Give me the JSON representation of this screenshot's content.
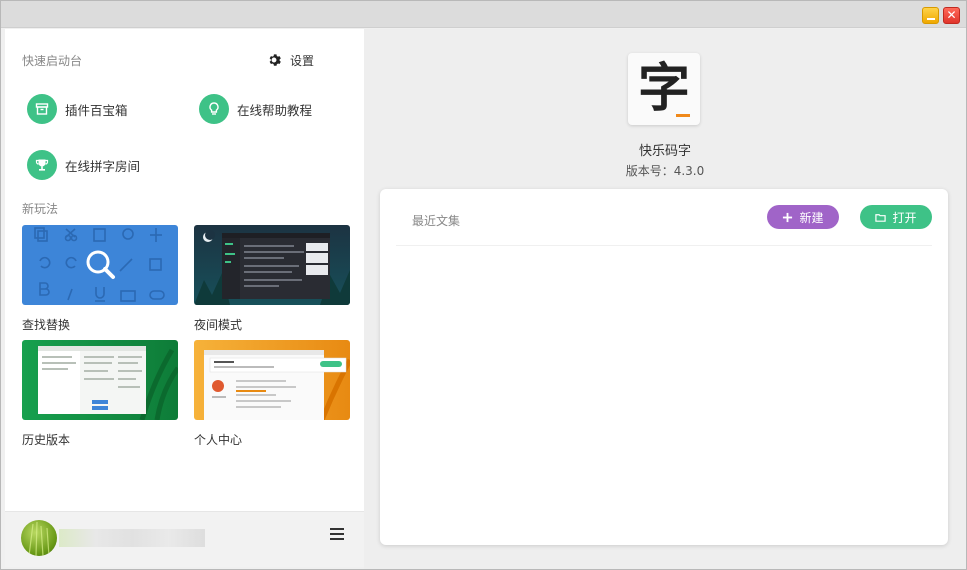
{
  "window": {
    "minimize_icon": "minimize-icon",
    "close_icon": "close-icon",
    "close_glyph": "✕"
  },
  "left": {
    "quick_start_title": "快速启动台",
    "settings_label": "设置",
    "tools": [
      {
        "label": "插件百宝箱",
        "icon": "archive-box-icon"
      },
      {
        "label": "在线帮助教程",
        "icon": "lightbulb-icon"
      },
      {
        "label": "在线拼字房间",
        "icon": "trophy-icon"
      }
    ],
    "new_play_title": "新玩法",
    "features": [
      {
        "label": "查找替换",
        "theme": "#3d85d8"
      },
      {
        "label": "夜间模式",
        "theme": "#1f3a4a"
      },
      {
        "label": "历史版本",
        "theme": "#1a9a4a"
      },
      {
        "label": "个人中心",
        "theme": "#f0a020"
      }
    ],
    "user": {
      "menu_icon": "hamburger-menu-icon"
    }
  },
  "right": {
    "app_logo_glyph": "字",
    "app_name": "快乐码字",
    "version": "版本号：4.3.0",
    "recent_title": "最近文集",
    "new_button": "新建",
    "open_button": "打开"
  },
  "colors": {
    "accent_green": "#3ec287",
    "accent_purple": "#a064c8"
  }
}
